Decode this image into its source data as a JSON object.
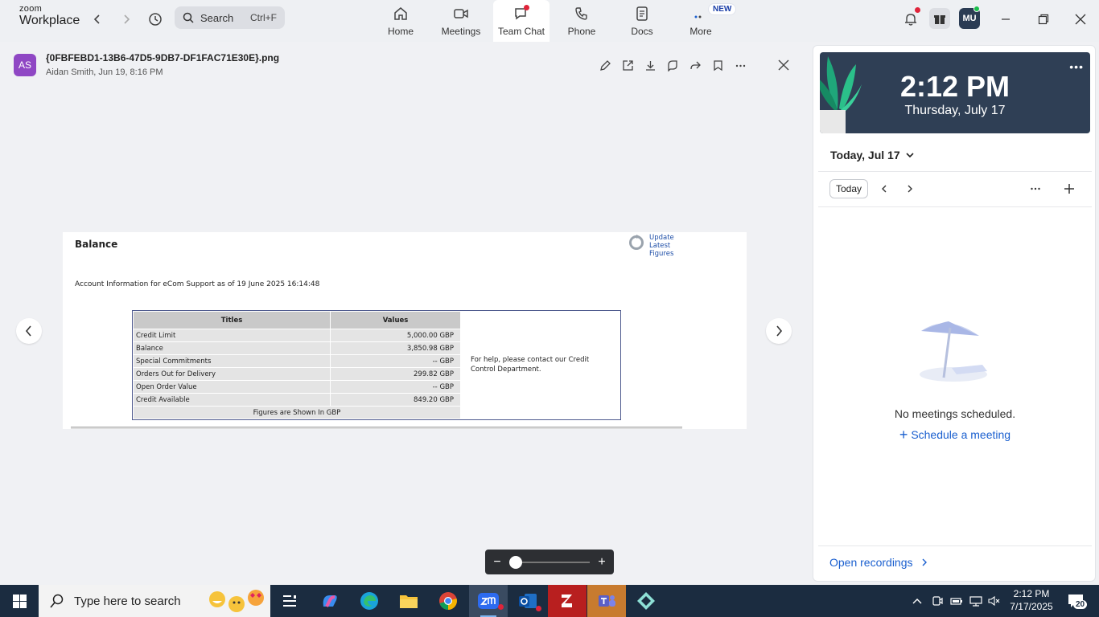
{
  "app": {
    "logo_top": "zoom",
    "logo_bottom": "Workplace"
  },
  "search": {
    "label": "Search",
    "shortcut": "Ctrl+F"
  },
  "nav": [
    {
      "label": "Home"
    },
    {
      "label": "Meetings"
    },
    {
      "label": "Team Chat"
    },
    {
      "label": "Phone"
    },
    {
      "label": "Docs"
    },
    {
      "label": "More",
      "badge": "NEW"
    }
  ],
  "user": {
    "initials": "MU"
  },
  "file": {
    "sender_initials": "AS",
    "name": "{0FBFEBD1-13B6-47D5-9DB7-DF1FAC71E30E}.png",
    "meta": "Aidan Smith, Jun 19, 8:16 PM"
  },
  "doc": {
    "title": "Balance",
    "update_lines": [
      "Update",
      "Latest",
      "Figures"
    ],
    "info": "Account Information for eCom Support as of 19 June 2025 16:14:48",
    "headers": [
      "Titles",
      "Values"
    ],
    "rows": [
      {
        "title": "Credit Limit",
        "value": "5,000.00 GBP"
      },
      {
        "title": "Balance",
        "value": "3,850.98 GBP"
      },
      {
        "title": "Special Commitments",
        "value": "-- GBP"
      },
      {
        "title": "Orders Out for Delivery",
        "value": "299.82 GBP"
      },
      {
        "title": "Open Order Value",
        "value": "-- GBP"
      },
      {
        "title": "Credit Available",
        "value": "849.20 GBP"
      }
    ],
    "footer": "Figures are Shown In GBP",
    "help": "For help, please contact our Credit Control Department."
  },
  "zoom": {
    "level": 0.0
  },
  "panel": {
    "time": "2:12 PM",
    "date": "Thursday, July 17",
    "day_selector": "Today, Jul 17",
    "today_button": "Today",
    "empty": "No meetings scheduled.",
    "schedule": "Schedule a meeting",
    "recordings": "Open recordings"
  },
  "taskbar": {
    "search_placeholder": "Type here to search",
    "time": "2:12 PM",
    "date": "7/17/2025",
    "notifications": "20"
  }
}
